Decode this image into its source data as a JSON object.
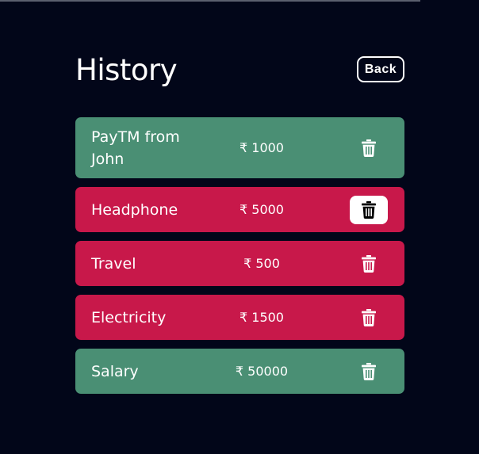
{
  "header": {
    "title": "History",
    "back_label": "Back"
  },
  "colors": {
    "background": "#020619",
    "credit": "#4a8f74",
    "debit": "#c8184a"
  },
  "transactions": [
    {
      "name": "PayTM from John",
      "amount": "₹ 1000",
      "type": "credit"
    },
    {
      "name": "Headphone",
      "amount": "₹ 5000",
      "type": "debit",
      "delete_highlighted": true
    },
    {
      "name": "Travel",
      "amount": "₹ 500",
      "type": "debit"
    },
    {
      "name": "Electricity",
      "amount": "₹ 1500",
      "type": "debit"
    },
    {
      "name": "Salary",
      "amount": "₹ 50000",
      "type": "credit"
    }
  ],
  "icons": {
    "delete": "trash-icon"
  }
}
